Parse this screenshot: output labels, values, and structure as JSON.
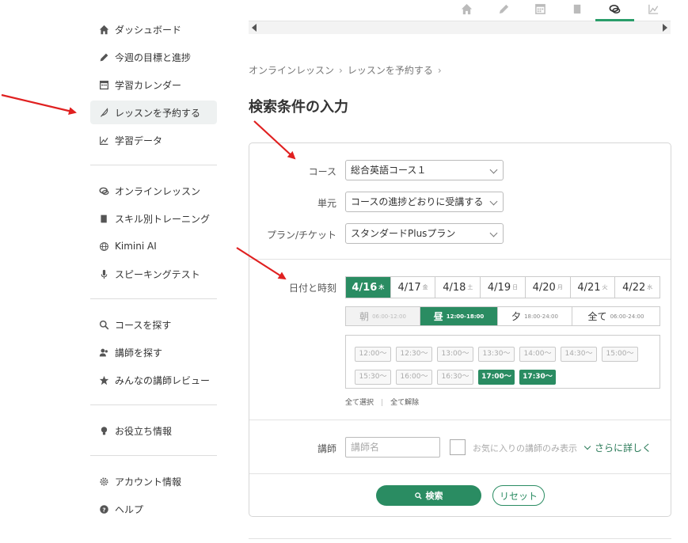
{
  "sidebar": {
    "groups": [
      [
        {
          "label": "ダッシュボード",
          "icon": "home-icon"
        },
        {
          "label": "今週の目標と進捗",
          "icon": "pencil-icon"
        },
        {
          "label": "学習カレンダー",
          "icon": "calendar-icon"
        },
        {
          "label": "レッスンを予約する",
          "icon": "feather-icon",
          "active": true
        },
        {
          "label": "学習データ",
          "icon": "chart-icon"
        }
      ],
      [
        {
          "label": "オンラインレッスン",
          "icon": "chat-icon"
        },
        {
          "label": "スキル別トレーニング",
          "icon": "book-icon"
        },
        {
          "label": "Kimini AI",
          "icon": "globe-icon"
        },
        {
          "label": "スピーキングテスト",
          "icon": "mic-icon"
        }
      ],
      [
        {
          "label": "コースを探す",
          "icon": "search-icon"
        },
        {
          "label": "講師を探す",
          "icon": "users-icon"
        },
        {
          "label": "みんなの講師レビュー",
          "icon": "star-icon"
        }
      ],
      [
        {
          "label": "お役立ち情報",
          "icon": "lightbulb-icon"
        }
      ],
      [
        {
          "label": "アカウント情報",
          "icon": "gear-icon"
        },
        {
          "label": "ヘルプ",
          "icon": "help-icon"
        }
      ]
    ]
  },
  "breadcrumb": [
    "オンラインレッスン",
    "レッスンを予約する"
  ],
  "page_title": "検索条件の入力",
  "form": {
    "course_label": "コース",
    "course_value": "総合英語コース１",
    "unit_label": "単元",
    "unit_value": "コースの進捗どおりに受講する",
    "plan_label": "プラン/チケット",
    "plan_value": "スタンダードPlusプラン",
    "date_label": "日付と時刻",
    "dates": [
      {
        "date": "4/16",
        "dow": "木",
        "active": true
      },
      {
        "date": "4/17",
        "dow": "金"
      },
      {
        "date": "4/18",
        "dow": "土"
      },
      {
        "date": "4/19",
        "dow": "日"
      },
      {
        "date": "4/20",
        "dow": "月"
      },
      {
        "date": "4/21",
        "dow": "火"
      },
      {
        "date": "4/22",
        "dow": "水"
      }
    ],
    "periods": [
      {
        "label": "朝",
        "range": "06:00-12:00",
        "state": "disabled"
      },
      {
        "label": "昼",
        "range": "12:00-18:00",
        "state": "active"
      },
      {
        "label": "夕",
        "range": "18:00-24:00",
        "state": ""
      },
      {
        "label": "全て",
        "range": "06:00-24:00",
        "state": ""
      }
    ],
    "slots": [
      {
        "time": "12:00〜"
      },
      {
        "time": "12:30〜"
      },
      {
        "time": "13:00〜"
      },
      {
        "time": "13:30〜"
      },
      {
        "time": "14:00〜"
      },
      {
        "time": "14:30〜"
      },
      {
        "time": "15:00〜"
      },
      {
        "time": "15:30〜"
      },
      {
        "time": "16:00〜"
      },
      {
        "time": "16:30〜"
      },
      {
        "time": "17:00〜",
        "active": true
      },
      {
        "time": "17:30〜",
        "active": true
      }
    ],
    "select_all": "全て選択",
    "deselect_all": "全て解除",
    "teacher_label": "講師",
    "teacher_placeholder": "講師名",
    "favorite_label": "お気に入りの講師のみ表示",
    "more_label": "さらに詳しく",
    "search_button": "検索",
    "reset_button": "リセット"
  },
  "colors": {
    "accent": "#2a8c62",
    "arrow": "#e02020"
  }
}
